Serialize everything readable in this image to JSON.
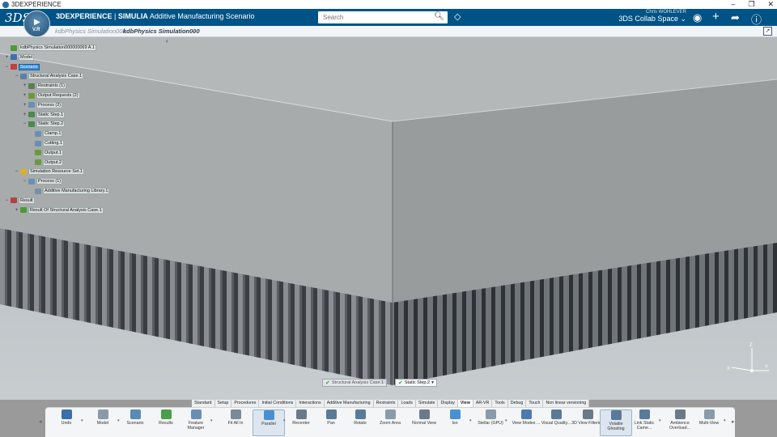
{
  "window": {
    "title": "3DEXPERIENCE",
    "controls": [
      "–",
      "❐",
      "✕"
    ]
  },
  "header": {
    "logo": "3DS",
    "compass_label": "V.R",
    "brand_prefix": "3DEXPERIENCE",
    "brand_separator": " | ",
    "brand_app": "SIMULIA",
    "brand_suffix": " Additive Manufacturing Scenario",
    "search_placeholder": "Search",
    "user_name": "Chris WOHLEVER",
    "collab_space": "3DS Collab Space ⌄",
    "icons": [
      "user-icon",
      "add-icon",
      "share-icon",
      "help-icon"
    ]
  },
  "tabs": [
    {
      "label": "kdbPhysics Simulation000",
      "active": false
    },
    {
      "label": "kdbPhysics Simulation000",
      "active": true
    }
  ],
  "tree": [
    {
      "label": "kdbPhysics Simulation000000069 A.1",
      "level": 0,
      "exp": "",
      "color": "#4a9a3a",
      "selected": false
    },
    {
      "label": "Model",
      "level": 0,
      "exp": "+",
      "color": "#3e6fb0",
      "selected": false
    },
    {
      "label": "Scenario",
      "level": 0,
      "exp": "−",
      "color": "#c04040",
      "selected": true
    },
    {
      "label": "Structural Analysis Case.1",
      "level": 1,
      "exp": "−",
      "color": "#5a7fa8",
      "selected": false
    },
    {
      "label": "Restraints (1)",
      "level": 2,
      "exp": "+",
      "color": "#5a8050",
      "selected": false
    },
    {
      "label": "Output Requests (2)",
      "level": 2,
      "exp": "+",
      "color": "#6a9a3a",
      "selected": false
    },
    {
      "label": "Process (2)",
      "level": 2,
      "exp": "+",
      "color": "#6a8fb5",
      "selected": false
    },
    {
      "label": "Static Step.1",
      "level": 2,
      "exp": "+",
      "color": "#4a8a4a",
      "selected": false
    },
    {
      "label": "Static Step.2",
      "level": 2,
      "exp": "−",
      "color": "#4a8a4a",
      "selected": false
    },
    {
      "label": "Clamp.1",
      "level": 3,
      "exp": "",
      "color": "#6a8fb5",
      "selected": false
    },
    {
      "label": "Cutting.1",
      "level": 3,
      "exp": "",
      "color": "#6a8fb5",
      "selected": false
    },
    {
      "label": "Output.1",
      "level": 3,
      "exp": "",
      "color": "#6a9a3a",
      "selected": false
    },
    {
      "label": "Output.2",
      "level": 3,
      "exp": "",
      "color": "#6a9a3a",
      "selected": false
    },
    {
      "label": "Simulation Resource Set.1",
      "level": 1,
      "exp": "−",
      "color": "#d8b030",
      "selected": false
    },
    {
      "label": "Process (1)",
      "level": 2,
      "exp": "−",
      "color": "#6a8fb5",
      "selected": false
    },
    {
      "label": "Additive Manufacturing Library.1",
      "level": 3,
      "exp": "",
      "color": "#7a8fa8",
      "selected": false
    },
    {
      "label": "Result",
      "level": 0,
      "exp": "−",
      "color": "#b84040",
      "selected": false
    },
    {
      "label": "Result Of Structural Analysis Case.1",
      "level": 1,
      "exp": "+",
      "color": "#4a9a3a",
      "selected": false
    }
  ],
  "steps": [
    {
      "label": "Structural Analysis Case.1",
      "active": false
    },
    {
      "label": "Static Step.2",
      "active": true
    }
  ],
  "axes": {
    "x": "X",
    "y": "Y",
    "z": "Z"
  },
  "action_tabs": [
    {
      "label": "Standard",
      "active": false
    },
    {
      "label": "Setup",
      "active": false
    },
    {
      "label": "Procedures",
      "active": false
    },
    {
      "label": "Initial Conditions",
      "active": false
    },
    {
      "label": "Interactions",
      "active": false
    },
    {
      "label": "Additive Manufacturing",
      "active": false
    },
    {
      "label": "Restraints",
      "active": false
    },
    {
      "label": "Loads",
      "active": false
    },
    {
      "label": "Simulate",
      "active": false
    },
    {
      "label": "Display",
      "active": false
    },
    {
      "label": "View",
      "active": true
    },
    {
      "label": "AR-VR",
      "active": false
    },
    {
      "label": "Tools",
      "active": false
    },
    {
      "label": "Debug",
      "active": false
    },
    {
      "label": "Touch",
      "active": false
    },
    {
      "label": "Non linear versioning",
      "active": false
    }
  ],
  "commands": [
    {
      "label": "Undo",
      "icon": "undo-icon",
      "color": "#3a6fa8",
      "dropdown": true,
      "selected": false
    },
    {
      "label": "Model",
      "icon": "model-icon",
      "color": "#8a9aaa",
      "dropdown": true,
      "selected": false
    },
    {
      "label": "Scenario",
      "icon": "scenario-icon",
      "color": "#5a8ab8",
      "dropdown": false,
      "selected": false
    },
    {
      "label": "Results",
      "icon": "results-icon",
      "color": "#4aa04a",
      "dropdown": false,
      "selected": false
    },
    {
      "label": "Feature Manager",
      "icon": "feature-manager-icon",
      "color": "#6a8fb5",
      "dropdown": true,
      "selected": false
    },
    {
      "label": "Fit All In",
      "icon": "fit-all-in-icon",
      "color": "#7a8a9a",
      "dropdown": false,
      "selected": false
    },
    {
      "label": "Parallel",
      "icon": "parallel-icon",
      "color": "#4a90d0",
      "dropdown": true,
      "selected": true
    },
    {
      "label": "Recenter",
      "icon": "recenter-icon",
      "color": "#6a7a8a",
      "dropdown": false,
      "selected": false
    },
    {
      "label": "Pan",
      "icon": "pan-icon",
      "color": "#5a7a9a",
      "dropdown": false,
      "selected": false
    },
    {
      "label": "Rotate",
      "icon": "rotate-icon",
      "color": "#5a7a9a",
      "dropdown": false,
      "selected": false
    },
    {
      "label": "Zoom Area",
      "icon": "zoom-area-icon",
      "color": "#8a9aaa",
      "dropdown": false,
      "selected": false
    },
    {
      "label": "Normal View",
      "icon": "normal-view-icon",
      "color": "#6a7a8a",
      "dropdown": false,
      "selected": false
    },
    {
      "label": "Iso",
      "icon": "iso-icon",
      "color": "#4a90d0",
      "dropdown": true,
      "selected": false
    },
    {
      "label": "Stellar (GPU)",
      "icon": "stellar-icon",
      "color": "#8a9aaa",
      "dropdown": true,
      "selected": false
    },
    {
      "label": "View Modes ...",
      "icon": "view-modes-icon",
      "color": "#4a7ab0",
      "dropdown": false,
      "selected": false
    },
    {
      "label": "Visual Quality...",
      "icon": "visual-quality-icon",
      "color": "#5a7a9a",
      "dropdown": false,
      "selected": false
    },
    {
      "label": "3D View Filtering",
      "icon": "view-filtering-icon",
      "color": "#6a7a8a",
      "dropdown": false,
      "selected": false
    },
    {
      "label": "Volatile Ghosting",
      "icon": "volatile-ghosting-icon",
      "color": "#5a7a9a",
      "dropdown": false,
      "selected": true
    },
    {
      "label": "Link Static Came...",
      "icon": "link-camera-icon",
      "color": "#5a7a9a",
      "dropdown": true,
      "selected": false
    },
    {
      "label": "Ambience Overload...",
      "icon": "ambience-icon",
      "color": "#6a7a8a",
      "dropdown": false,
      "selected": false
    },
    {
      "label": "Multi-View",
      "icon": "multi-view-icon",
      "color": "#8a9aaa",
      "dropdown": true,
      "selected": false
    }
  ]
}
